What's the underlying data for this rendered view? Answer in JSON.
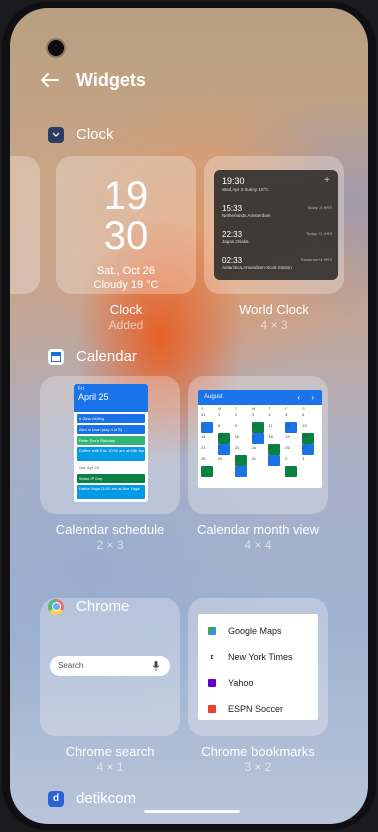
{
  "header": {
    "title": "Widgets"
  },
  "sections": {
    "clock": {
      "label": "Clock",
      "widgets": [
        {
          "name": "Clock",
          "sub": "Added",
          "preview": {
            "hour": "19",
            "minute": "30",
            "date": "Sat., Oct 26",
            "weather": "Cloudy  19 °C"
          }
        },
        {
          "name": "World Clock",
          "sub": "4 × 3",
          "preview": {
            "current_time": "19:30",
            "current_info": "Wed,Apr 3 Sunny 19°C",
            "add": "+",
            "rows": [
              {
                "time": "15:33",
                "city": "Netherlands,Amsterdam",
                "diff": "Today -4 HRS"
              },
              {
                "time": "22:33",
                "city": "Japan,Osaka",
                "diff": "Today +1 HRS"
              },
              {
                "time": "02:33",
                "city": "Antarctica,Amundsen-Scott Station",
                "diff": "Tomorrow+4 HRS"
              }
            ]
          }
        }
      ]
    },
    "calendar": {
      "label": "Calendar",
      "widgets": [
        {
          "name": "Calendar schedule",
          "sub": "2 × 3",
          "preview": {
            "day": "Fri",
            "date": "April 25",
            "events": [
              {
                "text": "# Gina visiting",
                "color": "#1a73e8"
              },
              {
                "text": "Alex in town (day 4 of 5)",
                "color": "#1a73e8"
              },
              {
                "text": "Peter Fox's Birthday",
                "color": "#33b679"
              },
              {
                "text": "Coffee with Eric 10:00 am at Milk Bar",
                "color": "#039be5"
              },
              {
                "text": "Sat, Apr 26",
                "color": "#ffffff"
              },
              {
                "text": "World IP Day",
                "color": "#0b8043"
              },
              {
                "text": "Hatha Yoga 11:00 am at Ace Yoga",
                "color": "#039be5"
              }
            ]
          }
        },
        {
          "name": "Calendar month view",
          "sub": "4 × 4",
          "preview": {
            "month": "August",
            "prev": "‹",
            "next": "›",
            "weekdays": [
              "S",
              "M",
              "T",
              "W",
              "T",
              "F",
              "S"
            ],
            "days": [
              "31",
              "1",
              "2",
              "3",
              "4",
              "5",
              "6",
              "7",
              "8",
              "9",
              "10",
              "11",
              "12",
              "13",
              "14",
              "15",
              "16",
              "17",
              "18",
              "19",
              "20",
              "21",
              "22",
              "23",
              "24",
              "25",
              "26",
              "27",
              "28",
              "29",
              "30",
              "31",
              "1",
              "2",
              "3"
            ]
          }
        }
      ]
    },
    "chrome": {
      "label": "Chrome",
      "widgets": [
        {
          "name": "Chrome search",
          "sub": "4 × 1",
          "preview": {
            "placeholder": "Search"
          }
        },
        {
          "name": "Chrome bookmarks",
          "sub": "3 × 2",
          "preview": {
            "bookmarks": [
              {
                "label": "Google Maps"
              },
              {
                "label": "New York Times"
              },
              {
                "label": "Yahoo"
              },
              {
                "label": "ESPN Soccer"
              }
            ]
          }
        }
      ]
    },
    "detikcom": {
      "label": "detikcom"
    }
  },
  "colors": {
    "calendar_blue": "#1a73e8",
    "chrome_red": "#db4437",
    "detik_blue": "#2a63d5"
  }
}
